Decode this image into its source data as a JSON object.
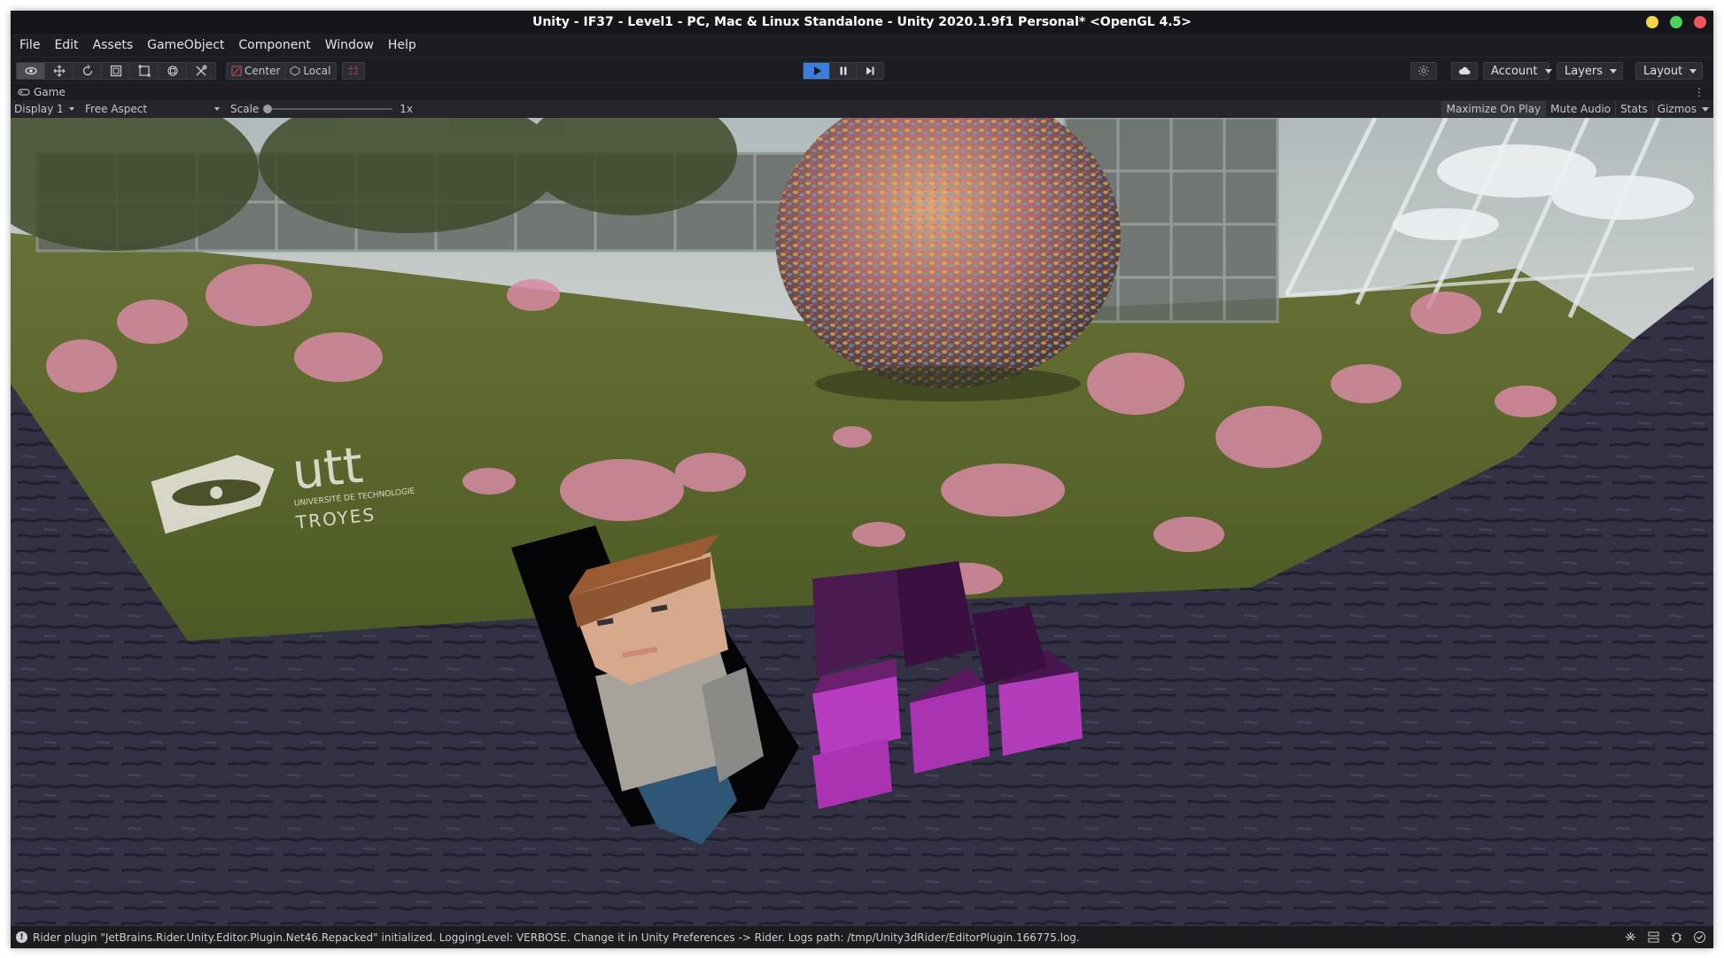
{
  "window": {
    "title": "Unity - IF37 - Level1 - PC, Mac & Linux Standalone - Unity 2020.1.9f1 Personal* <OpenGL 4.5>",
    "controls": {
      "minimize_color": "#f5d547",
      "maximize_color": "#4ad45a",
      "close_color": "#f2545b"
    }
  },
  "menu": [
    "File",
    "Edit",
    "Assets",
    "GameObject",
    "Component",
    "Window",
    "Help"
  ],
  "toolbar": {
    "tools": [
      "eye-icon",
      "move-icon",
      "rotate-icon",
      "scale-icon",
      "rect-icon",
      "transform-icon",
      "custom-tool-icon"
    ],
    "pivot_label": "Center",
    "space_label": "Local",
    "play_active": true,
    "account_label": "Account",
    "layers_label": "Layers",
    "layout_label": "Layout"
  },
  "game_tab": {
    "label": "Game",
    "display": "Display 1",
    "aspect": "Free Aspect",
    "scale_label": "Scale",
    "scale_value": "1x",
    "scale_level": 0,
    "maximize_on_play": "Maximize On Play",
    "mute_audio": "Mute Audio",
    "stats": "Stats",
    "gizmos": "Gizmos"
  },
  "scene": {
    "billboard_logo": "utt",
    "billboard_sub": "UNIVERSITÉ DE TECHNOLOGIE",
    "billboard_city": "TROYES"
  },
  "status": {
    "message": "Rider plugin \"JetBrains.Rider.Unity.Editor.Plugin.Net46.Repacked\" initialized. LoggingLevel: VERBOSE. Change it in Unity Preferences -> Rider. Logs path: /tmp/Unity3dRider/EditorPlugin.166775.log."
  },
  "colors": {
    "accent": "#3b7dd8",
    "editor_bg": "#1c1c21",
    "floor": "#3a3a4e",
    "cube_magenta": "#b83cbf"
  }
}
